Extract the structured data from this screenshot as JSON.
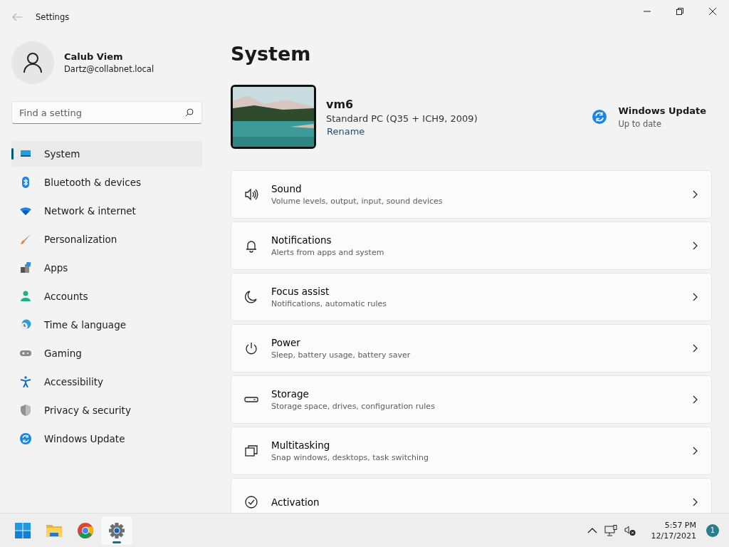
{
  "window": {
    "title": "Settings"
  },
  "user": {
    "name": "Calub Viem",
    "email": "Dartz@collabnet.local"
  },
  "search": {
    "placeholder": "Find a setting"
  },
  "nav": [
    {
      "label": "System",
      "selected": true
    },
    {
      "label": "Bluetooth & devices",
      "selected": false
    },
    {
      "label": "Network & internet",
      "selected": false
    },
    {
      "label": "Personalization",
      "selected": false
    },
    {
      "label": "Apps",
      "selected": false
    },
    {
      "label": "Accounts",
      "selected": false
    },
    {
      "label": "Time & language",
      "selected": false
    },
    {
      "label": "Gaming",
      "selected": false
    },
    {
      "label": "Accessibility",
      "selected": false
    },
    {
      "label": "Privacy & security",
      "selected": false
    },
    {
      "label": "Windows Update",
      "selected": false
    }
  ],
  "page_title": "System",
  "device": {
    "name": "vm6",
    "model": "Standard PC (Q35 + ICH9, 2009)",
    "rename": "Rename"
  },
  "update": {
    "title": "Windows Update",
    "status": "Up to date"
  },
  "cards": [
    {
      "title": "Sound",
      "subtitle": "Volume levels, output, input, sound devices"
    },
    {
      "title": "Notifications",
      "subtitle": "Alerts from apps and system"
    },
    {
      "title": "Focus assist",
      "subtitle": "Notifications, automatic rules"
    },
    {
      "title": "Power",
      "subtitle": "Sleep, battery usage, battery saver"
    },
    {
      "title": "Storage",
      "subtitle": "Storage space, drives, configuration rules"
    },
    {
      "title": "Multitasking",
      "subtitle": "Snap windows, desktops, task switching"
    },
    {
      "title": "Activation"
    }
  ],
  "taskbar": {
    "apps": [
      {
        "selected": false
      },
      {
        "selected": false
      },
      {
        "selected": false
      },
      {
        "selected": true
      }
    ],
    "time": "5:57 PM",
    "date": "12/17/2021",
    "notifications": "1"
  }
}
